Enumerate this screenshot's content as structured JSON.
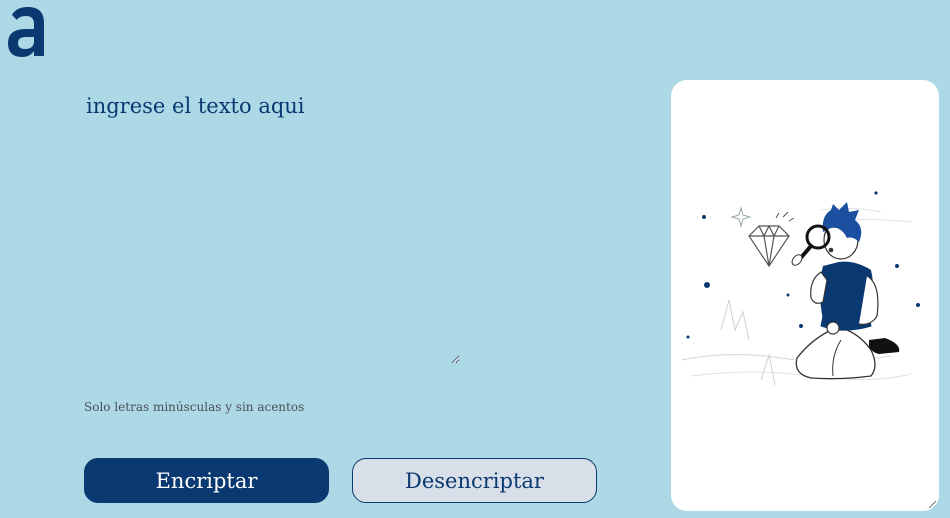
{
  "app": {
    "logo_icon": "alura-a-logo-icon"
  },
  "editor": {
    "placeholder": "ingrese el texto aqui",
    "value": ""
  },
  "hint": {
    "text": "Solo letras minúsculas y sin acentos"
  },
  "buttons": {
    "encrypt_label": "Encriptar",
    "decrypt_label": "Desencriptar"
  },
  "output": {
    "illustration": "person-with-magnifying-glass-diamond-illustration"
  },
  "colors": {
    "background": "#add8e6",
    "primary": "#0a3871",
    "secondary_button": "#d8dfe8",
    "panel": "#ffffff",
    "hint_text": "#495057"
  }
}
